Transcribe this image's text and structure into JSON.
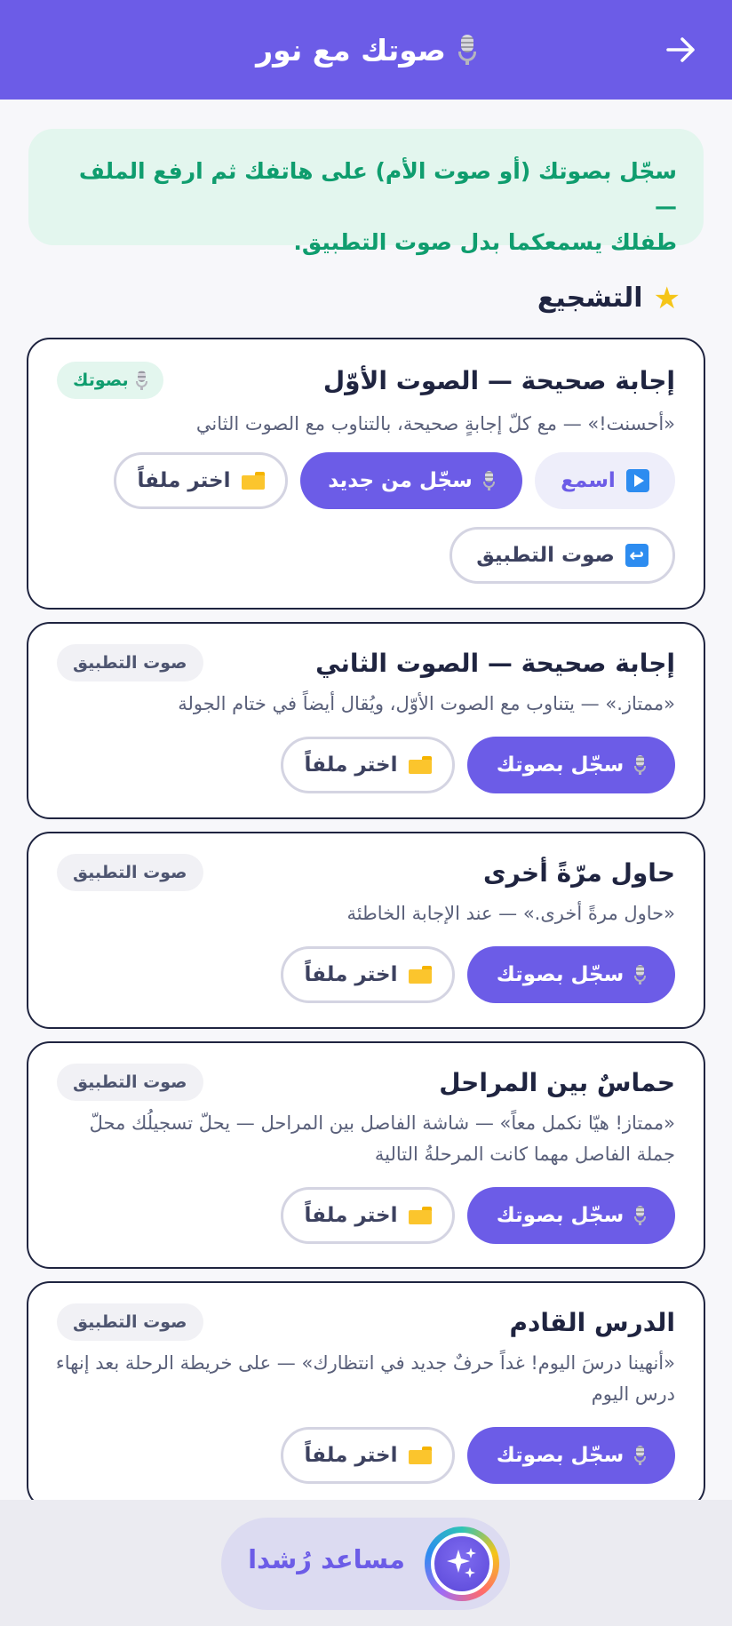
{
  "header": {
    "title": "صوتك مع نور",
    "icon": "microphone-icon",
    "back_icon": "arrow-right-icon",
    "bg_color": "#6c5ce7"
  },
  "info": {
    "line1": "سجّل بصوتك (أو صوت الأم) على هاتفك ثم ارفع الملف —",
    "line2": "طفلك يسمعكما بدل صوت التطبيق."
  },
  "section": {
    "title": "التشجيع",
    "icon": "star-icon"
  },
  "cards": [
    {
      "title": "إجابة صحيحة — الصوت الأوّل",
      "badge": "بصوتك",
      "desc": "«أحسنت!» — مع كلّ إجابةٍ صحيحة، بالتناوب مع الصوت الثاني",
      "listen": "اسمع",
      "rerecord": "سجّل من جديد",
      "choose": "اختر ملفاً",
      "revert": "صوت التطبيق"
    },
    {
      "title": "إجابة صحيحة — الصوت الثاني",
      "badge": "صوت التطبيق",
      "desc": "«ممتاز.» — يتناوب مع الصوت الأوّل، ويُقال أيضاً في ختام الجولة",
      "record": "سجّل بصوتك",
      "choose": "اختر ملفاً"
    },
    {
      "title": "حاول مرّةً أخرى",
      "badge": "صوت التطبيق",
      "desc": "«حاول مرةً أخرى.» — عند الإجابة الخاطئة",
      "record": "سجّل بصوتك",
      "choose": "اختر ملفاً"
    },
    {
      "title": "حماسٌ بين المراحل",
      "badge": "صوت التطبيق",
      "desc": "«ممتاز! هيّا نكمل معاً» — شاشة الفاصل بين المراحل — يحلّ تسجيلُك محلّ جملة الفاصل مهما كانت المرحلةُ التالية",
      "record": "سجّل بصوتك",
      "choose": "اختر ملفاً"
    },
    {
      "title": "الدرس القادم",
      "badge": "صوت التطبيق",
      "desc": "«أنهينا درسَ اليوم! غداً حرفٌ جديد في انتظارك» — على خريطة الرحلة بعد إنهاء درس اليوم",
      "record": "سجّل بصوتك",
      "choose": "اختر ملفاً"
    }
  ],
  "assistant": {
    "label": "مساعد رُشدا",
    "icon": "sparkles-icon"
  }
}
